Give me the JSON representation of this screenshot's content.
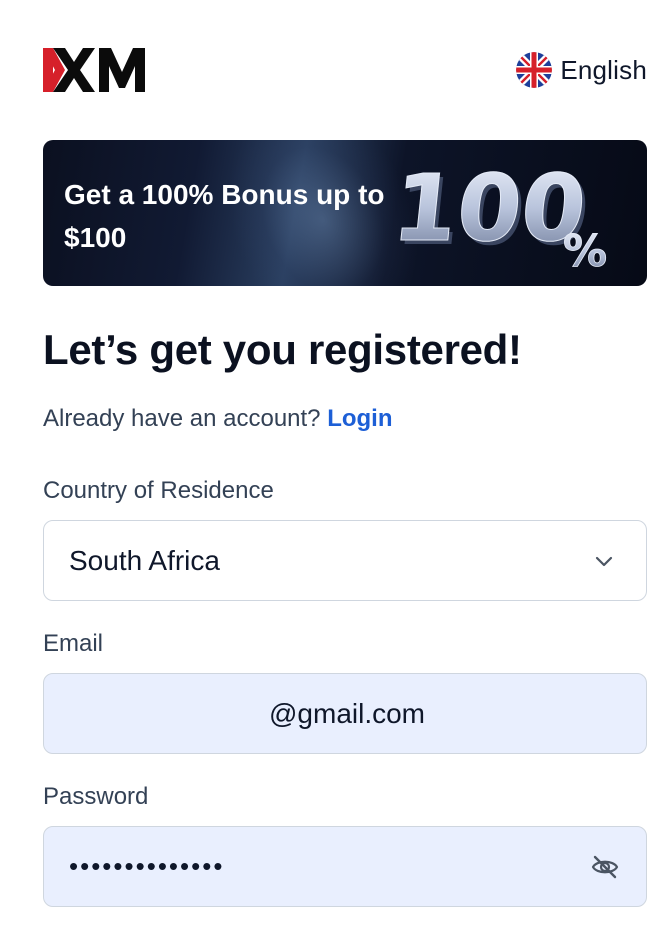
{
  "header": {
    "logo_text": "XM",
    "language": {
      "label": "English",
      "flag_icon": "uk-flag-icon"
    }
  },
  "banner": {
    "title": "Get a 100% Bonus up to $100",
    "graphic_text": "100%"
  },
  "form": {
    "heading": "Let’s get you registered!",
    "login_prompt": "Already have an account?",
    "login_link": "Login",
    "country": {
      "label": "Country of Residence",
      "value": "South Africa",
      "icon": "chevron-down-icon"
    },
    "email": {
      "label": "Email",
      "value": "@gmail.com"
    },
    "password": {
      "label": "Password",
      "value": "••••••••••••••",
      "icon": "eye-off-icon"
    }
  },
  "colors": {
    "accent_link": "#1d5fd6",
    "logo_red": "#d6202a",
    "input_fill": "#e9effe",
    "banner_bg": "#0b1020"
  }
}
